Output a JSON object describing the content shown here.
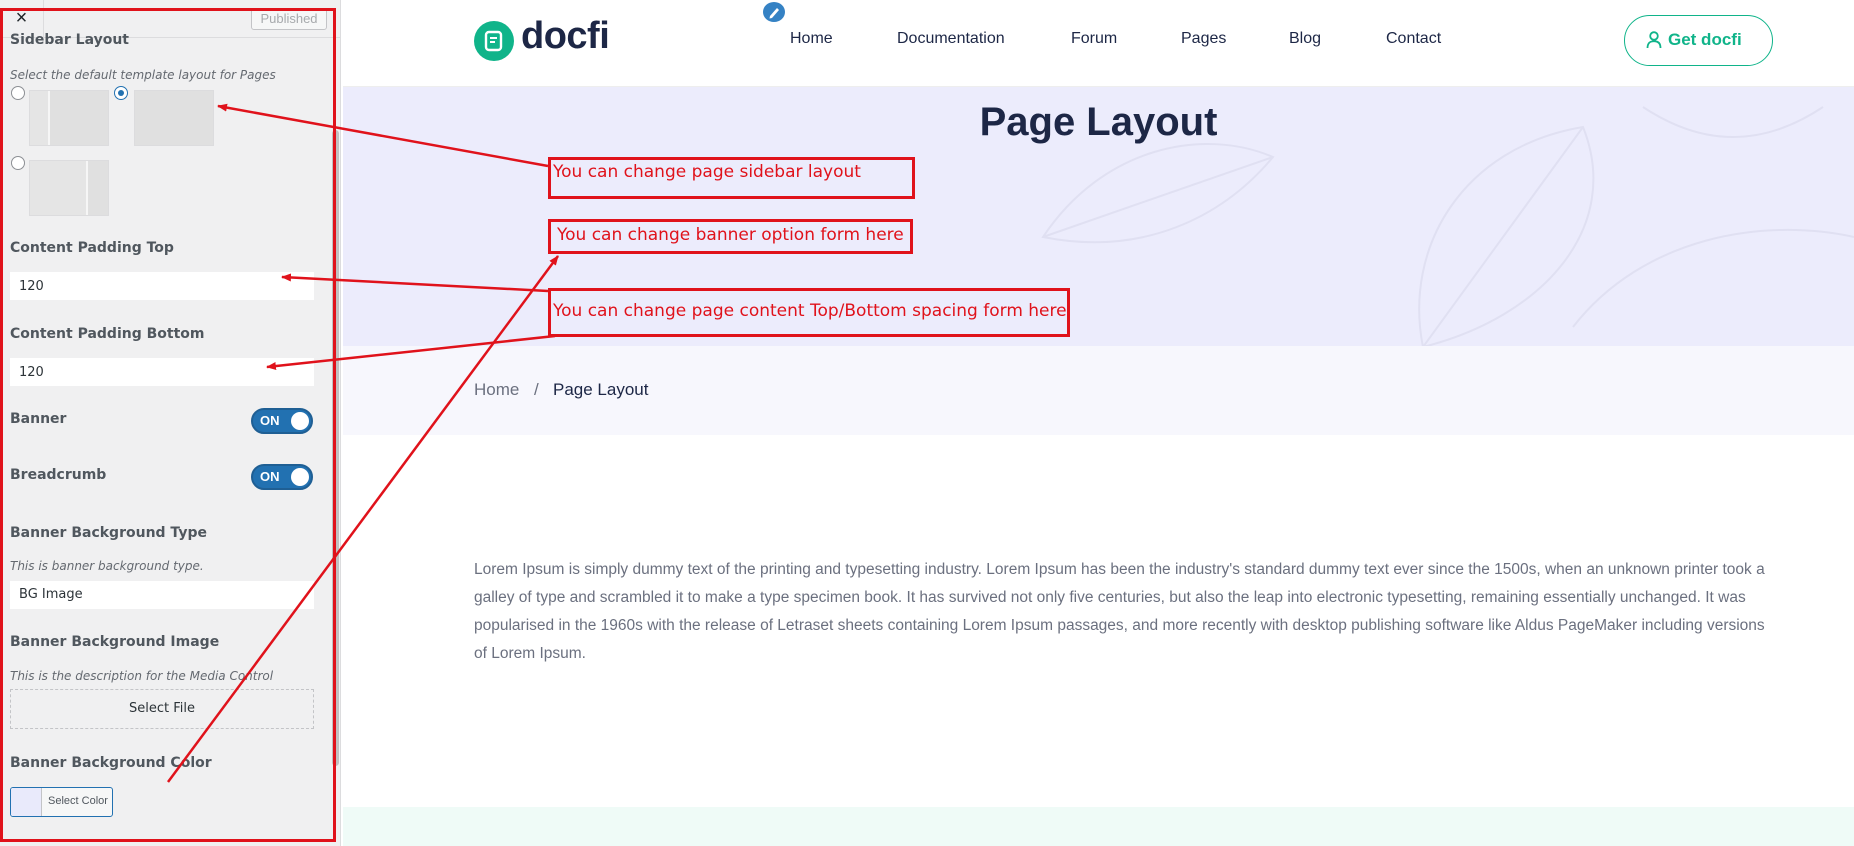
{
  "customizer": {
    "close_label": "×",
    "publish_label": "Published",
    "sidebar_layout": {
      "title": "Sidebar Layout",
      "description": "Select the default template layout for Pages"
    },
    "padding_top": {
      "title": "Content Padding Top",
      "value": "120"
    },
    "padding_bottom": {
      "title": "Content Padding Bottom",
      "value": "120"
    },
    "banner": {
      "title": "Banner",
      "state": "ON"
    },
    "breadcrumb": {
      "title": "Breadcrumb",
      "state": "ON"
    },
    "banner_bg_type": {
      "title": "Banner Background Type",
      "description": "This is banner background type.",
      "value": "BG Image"
    },
    "banner_bg_image": {
      "title": "Banner Background Image",
      "description": "This is the description for the Media Control",
      "button": "Select File"
    },
    "banner_bg_color": {
      "title": "Banner Background Color",
      "button": "Select Color",
      "swatch": "#e9eafb"
    }
  },
  "site": {
    "logo_text": "docfi",
    "nav": [
      "Home",
      "Documentation",
      "Forum",
      "Pages",
      "Blog",
      "Contact"
    ],
    "cta_label": "Get docfi",
    "banner_title": "Page Layout",
    "breadcrumb": {
      "home": "Home",
      "separator": "/",
      "current": "Page Layout"
    },
    "body_text": "Lorem Ipsum is simply dummy text of the printing and typesetting industry. Lorem Ipsum has been the industry's standard dummy text ever since the 1500s, when an unknown printer took a galley of type and scrambled it to make a type specimen book. It has survived not only five centuries, but also the leap into electronic typesetting, remaining essentially unchanged. It was popularised in the 1960s with the release of Letraset sheets containing Lorem Ipsum passages, and more recently with desktop publishing software like Aldus PageMaker including versions of Lorem Ipsum."
  },
  "annotations": {
    "sidebar_note": "You can change page sidebar layout",
    "banner_note": "You can change banner option form here",
    "spacing_note": "You can change page content Top/Bottom spacing form here"
  },
  "colors": {
    "brand_green": "#10b48a",
    "brand_dark": "#1d2746",
    "annotation_red": "#e0121b",
    "wp_blue": "#2271b1"
  }
}
